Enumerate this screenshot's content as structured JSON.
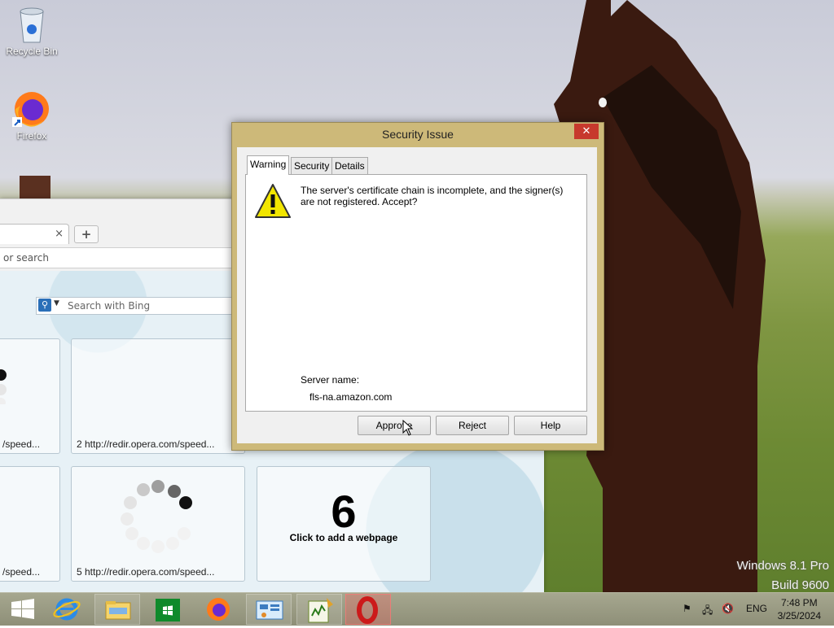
{
  "desktop": {
    "icons": [
      {
        "label": "Recycle Bin",
        "icon": "recycle-bin-icon"
      },
      {
        "label": "Firefox",
        "icon": "firefox-icon"
      }
    ],
    "brand_line1": "Windows 8.1 Pro",
    "brand_line2": "Build 9600"
  },
  "browser": {
    "tab_close": "×",
    "new_tab": "+",
    "address_placeholder": "or search",
    "search_placeholder": "Search with Bing",
    "tiles": [
      {
        "caption": "/speed..."
      },
      {
        "caption": "2  http://redir.opera.com/speed..."
      },
      {
        "caption": "/speed..."
      },
      {
        "caption": "5  http://redir.opera.com/speed..."
      },
      {
        "number": "6",
        "caption": "Click to add a webpage"
      }
    ]
  },
  "dialog": {
    "title": "Security Issue",
    "close": "✕",
    "tabs": [
      "Warning",
      "Security",
      "Details"
    ],
    "active_tab": "Warning",
    "message": "The server's certificate chain is incomplete, and the signer(s) are not registered. Accept?",
    "server_label": "Server name:",
    "server_name": "fls-na.amazon.com",
    "buttons": {
      "approve": "Approve",
      "reject": "Reject",
      "help": "Help"
    }
  },
  "taskbar": {
    "apps": [
      "start-icon",
      "internet-explorer-icon",
      "file-explorer-icon",
      "store-icon",
      "firefox-icon",
      "control-panel-icon",
      "notepad-plus-icon",
      "opera-icon"
    ],
    "language": "ENG",
    "time": "7:48 PM",
    "date": "3/25/2024"
  },
  "colors": {
    "dialog_frame": "#cdb979",
    "close_button": "#c7392d",
    "taskbar": "#9a9b84",
    "opera_red": "#cc1a1a"
  }
}
